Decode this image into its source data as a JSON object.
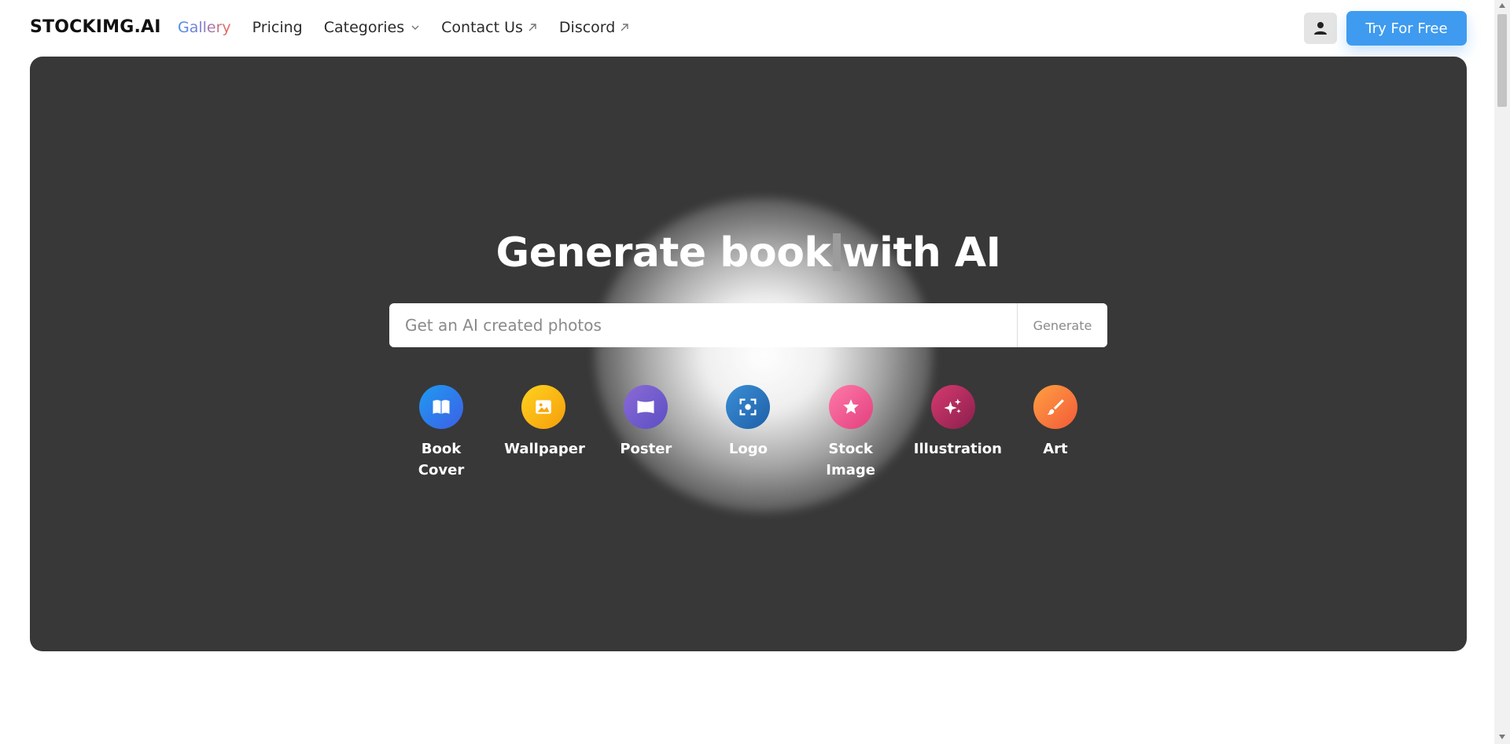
{
  "nav": {
    "logo": "STOCKIMG.AI",
    "links": [
      {
        "label": "Gallery"
      },
      {
        "label": "Pricing"
      },
      {
        "label": "Categories"
      },
      {
        "label": "Contact Us"
      },
      {
        "label": "Discord"
      }
    ],
    "cta_label": "Try For Free"
  },
  "hero": {
    "headline_prefix": "Generate book",
    "headline_suffix": "with AI",
    "search": {
      "placeholder": "Get an AI created photos",
      "value": "",
      "button_label": "Generate"
    },
    "categories": [
      {
        "label": "Book Cover",
        "icon": "book-icon",
        "color_from": "#1e9bf0",
        "color_to": "#3d5fe6"
      },
      {
        "label": "Wallpaper",
        "icon": "image-icon",
        "color_from": "#ffd21f",
        "color_to": "#f59e0b"
      },
      {
        "label": "Poster",
        "icon": "poster-icon",
        "color_from": "#8b6ad6",
        "color_to": "#5b4fc4"
      },
      {
        "label": "Logo",
        "icon": "focus-icon",
        "color_from": "#3a8fd6",
        "color_to": "#1e5fa8"
      },
      {
        "label": "Stock Image",
        "icon": "star-icon",
        "color_from": "#ff7aa8",
        "color_to": "#e23f7e"
      },
      {
        "label": "Illustration",
        "icon": "sparkles-icon",
        "color_from": "#d63a6e",
        "color_to": "#8a1f4e"
      },
      {
        "label": "Art",
        "icon": "brush-icon",
        "color_from": "#ffa041",
        "color_to": "#f25a39"
      }
    ]
  },
  "colors": {
    "accent": "#3e9bef",
    "hero_bg": "#383838"
  }
}
